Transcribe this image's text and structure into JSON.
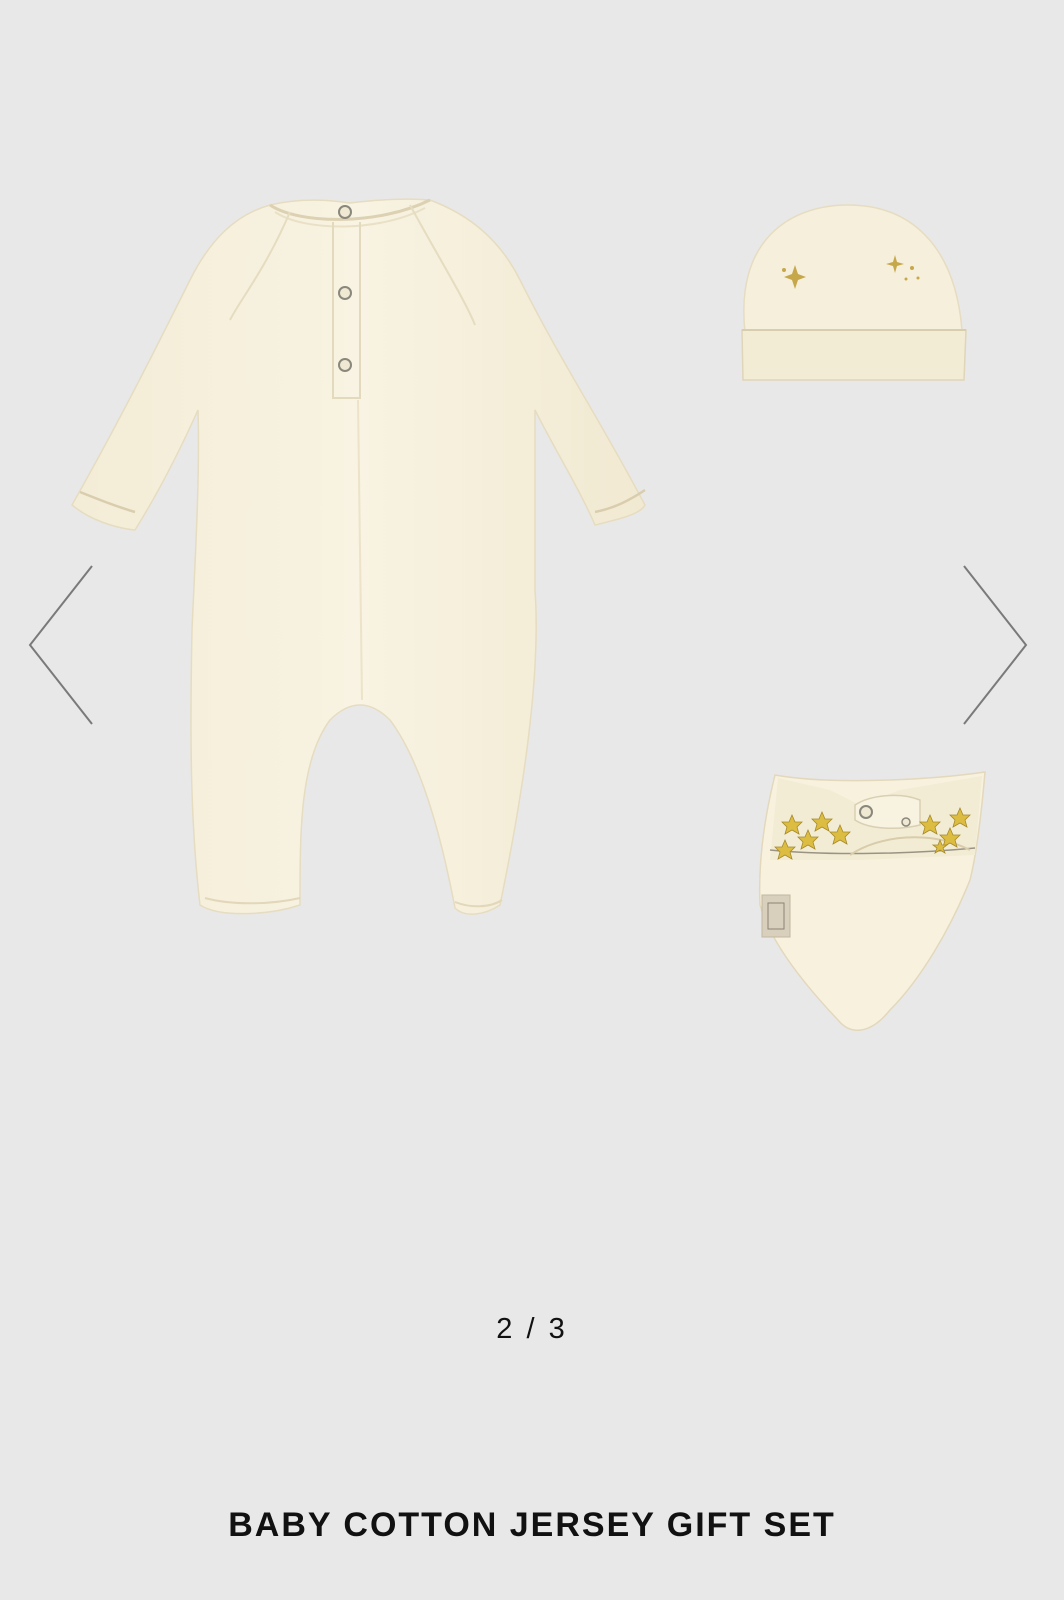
{
  "gallery": {
    "current_page": "2",
    "separator": "/",
    "total_pages": "3",
    "prev_icon": "chevron-left-icon",
    "next_icon": "chevron-right-icon",
    "items": [
      "onesie",
      "hat",
      "bib"
    ]
  },
  "product": {
    "title": "BABY COTTON JERSEY GIFT SET"
  },
  "colors": {
    "background": "#e8e8e8",
    "garment": "#f6f0dc",
    "star": "#d8b83c",
    "text": "#111111"
  }
}
